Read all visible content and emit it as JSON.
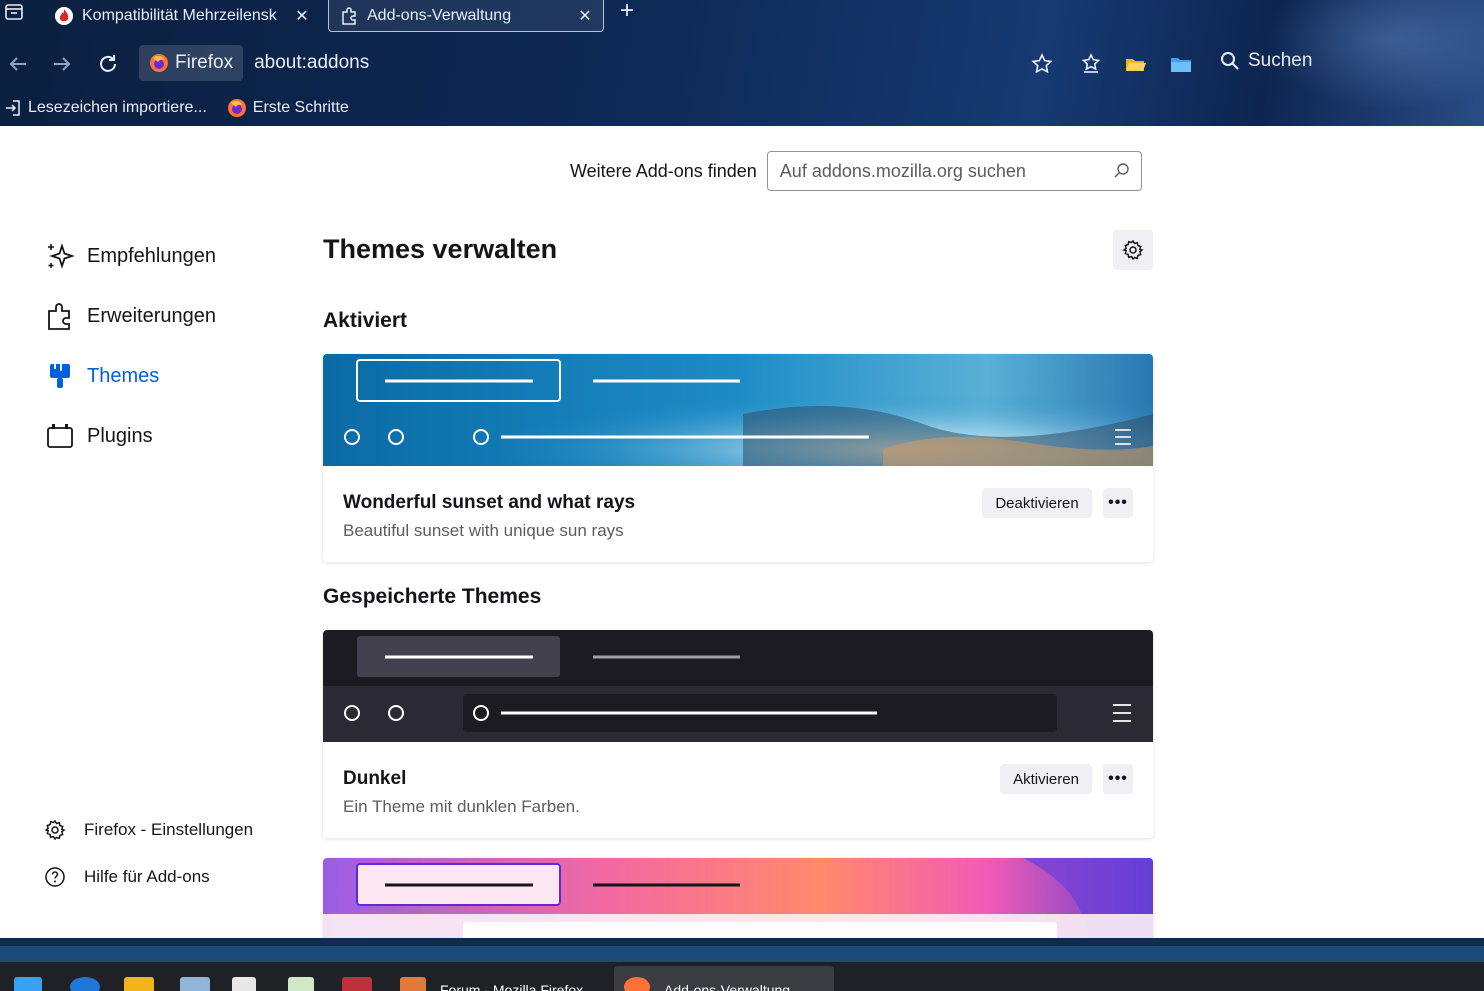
{
  "tabs": [
    {
      "label": "Kompatibilität Mehrzeilensk",
      "icon": "flame-favicon-icon"
    },
    {
      "label": "Add-ons-Verwaltung",
      "icon": "puzzle-icon"
    }
  ],
  "navbar": {
    "identity_label": "Firefox",
    "url": "about:addons",
    "search_label": "Suchen"
  },
  "bookmarks": [
    {
      "label": "Lesezeichen importiere...",
      "icon": "import-icon"
    },
    {
      "label": "Erste Schritte",
      "icon": "firefox-icon"
    }
  ],
  "find": {
    "label": "Weitere Add-ons finden",
    "placeholder": "Auf addons.mozilla.org suchen"
  },
  "sidebar": {
    "categories": [
      {
        "label": "Empfehlungen",
        "icon": "sparkle-icon"
      },
      {
        "label": "Erweiterungen",
        "icon": "puzzle-icon"
      },
      {
        "label": "Themes",
        "icon": "brush-icon",
        "selected": true
      },
      {
        "label": "Plugins",
        "icon": "plugin-icon"
      }
    ],
    "footer": [
      {
        "label": "Firefox - Einstellungen",
        "icon": "gear-icon"
      },
      {
        "label": "Hilfe für Add-ons",
        "icon": "help-icon"
      }
    ]
  },
  "main": {
    "title": "Themes verwalten",
    "enabled_heading": "Aktiviert",
    "saved_heading": "Gespeicherte Themes",
    "themes": [
      {
        "name": "Wonderful sunset and what rays",
        "description": "Beautiful sunset with unique sun rays",
        "action": "Deaktivieren"
      },
      {
        "name": "Dunkel",
        "description": "Ein Theme mit dunklen Farben.",
        "action": "Aktivieren"
      }
    ],
    "more_label": "•••"
  },
  "taskbar": {
    "items": [
      "Forum - Mozilla Firefox",
      "Add-ons-Verwaltung"
    ]
  },
  "colors": {
    "accent": "#0061e0",
    "chrome_bg": "#0e2a57",
    "button_bg": "#f0f0f4"
  }
}
